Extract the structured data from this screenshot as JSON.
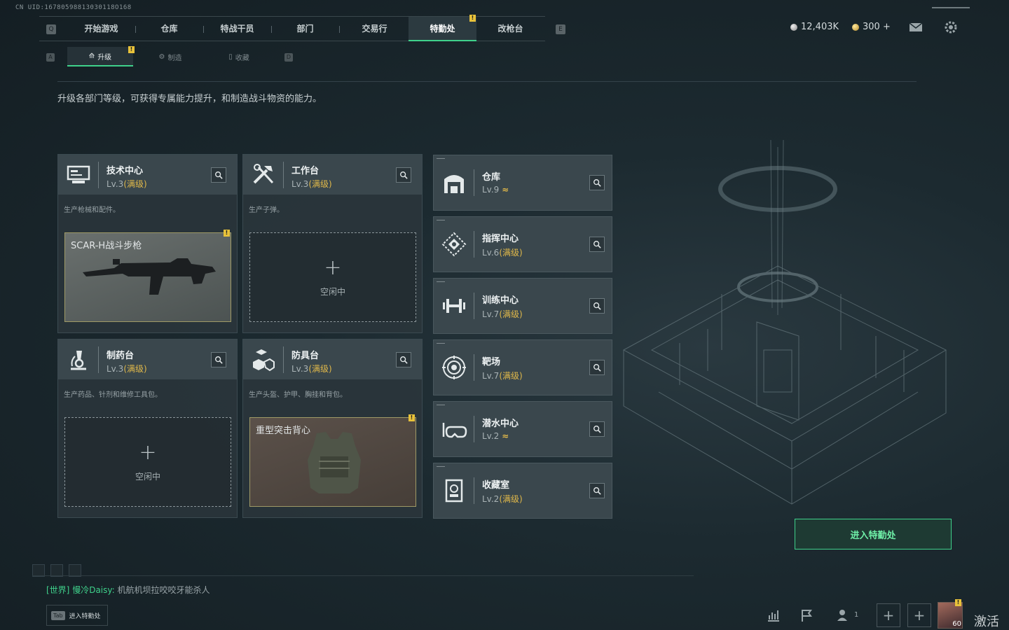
{
  "uid": "CN UID:16780598813030118O168",
  "nav": {
    "key_left": "Q",
    "key_right": "E",
    "items": [
      {
        "label": "开始游戏"
      },
      {
        "label": "仓库"
      },
      {
        "label": "特战干员"
      },
      {
        "label": "部门"
      },
      {
        "label": "交易行"
      },
      {
        "label": "特勤处",
        "active": true,
        "alert": "!"
      },
      {
        "label": "改枪台"
      }
    ]
  },
  "currency": {
    "primary": "12,403K",
    "secondary": "300 +"
  },
  "subtabs": {
    "key_left": "A",
    "key_right": "D",
    "items": [
      {
        "label": "升级",
        "active": true,
        "alert": "!"
      },
      {
        "label": "制造"
      },
      {
        "label": "收藏"
      }
    ]
  },
  "description": "升级各部门等级，可获得专属能力提升，和制造战斗物资的能力。",
  "cards": [
    {
      "name": "技术中心",
      "lv": "Lv.3",
      "max": "(满级)",
      "sub": "生产枪械和配件。",
      "slot_title": "SCAR-H战斗步枪",
      "icon": "computer-icon"
    },
    {
      "name": "工作台",
      "lv": "Lv.3",
      "max": "(满级)",
      "sub": "生产子弹。",
      "slot_plus": "+",
      "slot_idle": "空闲中",
      "icon": "tools-icon"
    },
    {
      "name": "制药台",
      "lv": "Lv.3",
      "max": "(满级)",
      "sub": "生产药品、针剂和维修工具包。",
      "slot_plus": "+",
      "slot_idle": "空闲中",
      "icon": "microscope-icon"
    },
    {
      "name": "防具台",
      "lv": "Lv.3",
      "max": "(满级)",
      "sub": "生产头盔、护甲、胸挂和背包。",
      "slot_title": "重型突击背心",
      "icon": "blocks-icon"
    }
  ],
  "slot_alert": "!",
  "facilities": [
    {
      "name": "仓库",
      "lv": "Lv.9",
      "max": "",
      "up": "≈",
      "icon": "warehouse-icon"
    },
    {
      "name": "指挥中心",
      "lv": "Lv.6",
      "max": "(满级)",
      "icon": "command-icon"
    },
    {
      "name": "训练中心",
      "lv": "Lv.7",
      "max": "(满级)",
      "icon": "dumbbell-icon"
    },
    {
      "name": "靶场",
      "lv": "Lv.7",
      "max": "(满级)",
      "icon": "target-icon"
    },
    {
      "name": "潜水中心",
      "lv": "Lv.2",
      "max": "",
      "up": "≈",
      "icon": "dive-icon"
    },
    {
      "name": "收藏室",
      "lv": "Lv.2",
      "max": "(满级)",
      "icon": "collection-icon"
    }
  ],
  "enter_button": "进入特勤处",
  "chat": {
    "channel": "[世界]",
    "user": "慢冷Daisy:",
    "message": "机航机坝拉咬咬牙能杀人"
  },
  "tab_hint": {
    "key": "Tab",
    "label": "进入特勤处"
  },
  "bottom": {
    "friends_count": "1",
    "avatar_level": "60",
    "activate": "激活 V"
  }
}
